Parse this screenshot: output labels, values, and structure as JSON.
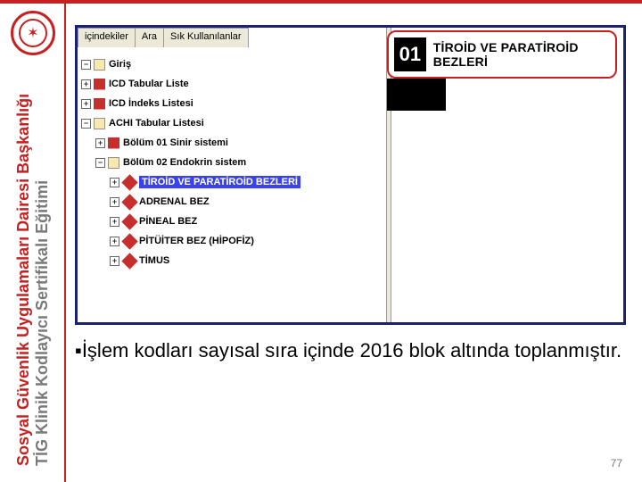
{
  "spine": {
    "red": "Sosyal Güvenlik Uygulamaları Dairesi Başkanlığı",
    "gray": "TİG Klinik Kodlayıcı Sertifikalı Eğitimi"
  },
  "tabs": {
    "t1": "içindekiler",
    "t2": "Ara",
    "t3": "Sık Kullanılanlar"
  },
  "tree": {
    "n1": "Giriş",
    "n2": "ICD Tabular Liste",
    "n3": "ICD İndeks Listesi",
    "n4": "ACHI Tabular Listesi",
    "n5": "Bölüm 01 Sinir sistemi",
    "n6": "Bölüm 02 Endokrin sistem",
    "n7": "TİROİD VE PARATİROİD BEZLERİ",
    "n8": "ADRENAL BEZ",
    "n9": "PİNEAL BEZ",
    "n10": "PİTÜİTER BEZ (HİPOFİZ)",
    "n11": "TİMUS"
  },
  "callout": {
    "code": "01",
    "title": "TİROİD VE PARATİROİD BEZLERİ"
  },
  "caption": "İşlem kodları sayısal sıra içinde 2016 blok altında toplanmıştır.",
  "pagenum": "77"
}
